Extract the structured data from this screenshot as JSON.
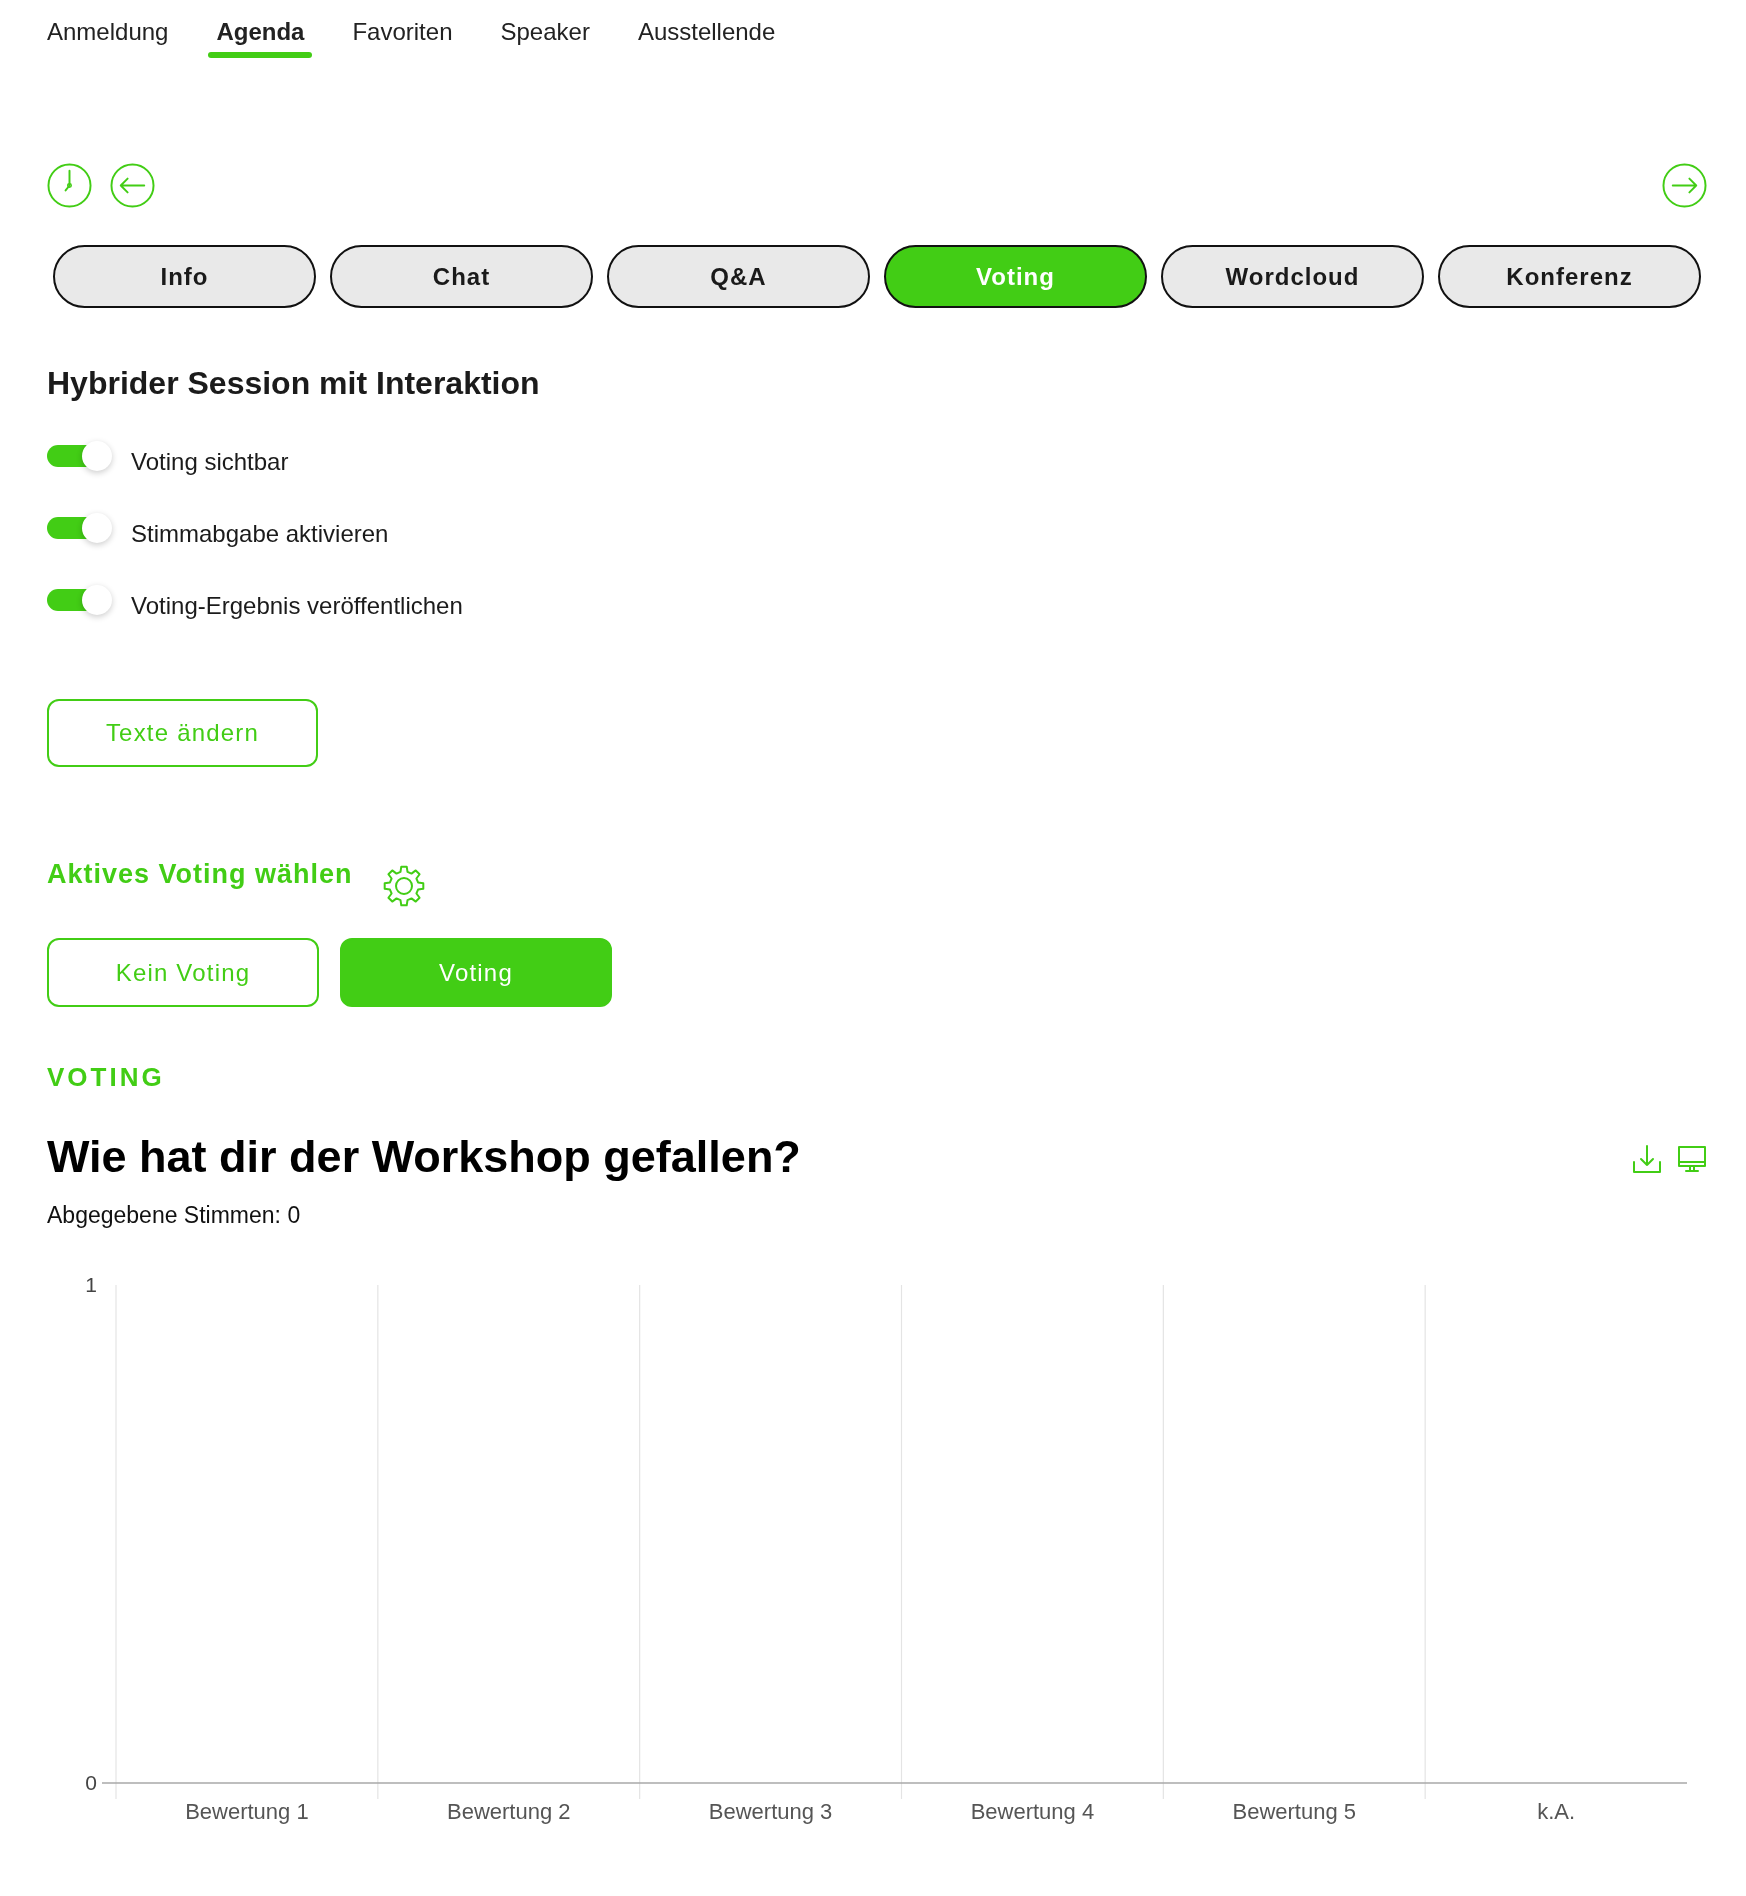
{
  "nav": [
    {
      "label": "Anmeldung",
      "selected": false
    },
    {
      "label": "Agenda",
      "selected": true
    },
    {
      "label": "Favoriten",
      "selected": false
    },
    {
      "label": "Speaker",
      "selected": false
    },
    {
      "label": "Ausstellende",
      "selected": false
    }
  ],
  "session_tabs": [
    {
      "label": "Info",
      "selected": false
    },
    {
      "label": "Chat",
      "selected": false
    },
    {
      "label": "Q&A",
      "selected": false
    },
    {
      "label": "Voting",
      "selected": true
    },
    {
      "label": "Wordcloud",
      "selected": false
    },
    {
      "label": "Konferenz",
      "selected": false
    }
  ],
  "session": {
    "title": "Hybrider Session mit Interaktion",
    "toggles": [
      {
        "label": "Voting sichtbar",
        "on": true
      },
      {
        "label": "Stimmabgabe aktivieren",
        "on": true
      },
      {
        "label": "Voting-Ergebnis veröffentlichen",
        "on": true
      }
    ],
    "edit_button": "Texte ändern"
  },
  "active_voting": {
    "heading": "Aktives Voting wählen",
    "options": [
      {
        "label": "Kein Voting",
        "selected": false
      },
      {
        "label": "Voting",
        "selected": true
      }
    ]
  },
  "voting": {
    "label": "VOTING",
    "question": "Wie hat dir der Workshop gefallen?",
    "votes": "Abgegebene Stimmen: 0",
    "chart_data": {
      "type": "bar",
      "categories": [
        "Bewertung 1",
        "Bewertung 2",
        "Bewertung 3",
        "Bewertung 4",
        "Bewertung 5",
        "k.A."
      ],
      "values": [
        0,
        0,
        0,
        0,
        0,
        0
      ],
      "ylim": [
        0,
        1
      ],
      "yticks": [
        0,
        1
      ]
    }
  }
}
